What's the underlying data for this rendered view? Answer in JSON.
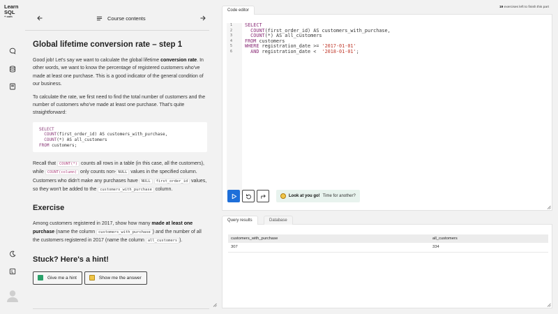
{
  "brand": {
    "line1": "Learn",
    "line2": "SQL",
    "line3": "+ com"
  },
  "nav": {
    "title": "Course contents"
  },
  "lesson": {
    "title": "Global lifetime conversion rate – step 1",
    "p1": {
      "a": "Good job! Let's say we want to calculate the global lifetime ",
      "b": "conversion rate",
      "c": ". In other words, we want to know the percentage of registered customers who've made at least one purchase. This is a good indicator of the general condition of our business."
    },
    "p2": "To calculate the rate, we first need to find the total number of customers and the number of customers who've made at least one purchase. That's quite straightforward:",
    "code_block": {
      "l1_kw": "SELECT",
      "l2_kw": "COUNT",
      "l2_rest": "(first_order_id) AS customers_with_purchase,",
      "l3_kw": "COUNT",
      "l3_rest": "(*) AS all_customers",
      "l4_kw": "FROM",
      "l4_rest": " customers;"
    },
    "p3": {
      "a": "Recall that ",
      "c1": "COUNT(*)",
      "b": " counts all rows in a table (in this case, all the customers), while ",
      "c2": "COUNT(column)",
      "c": " only counts non-",
      "c3": "NULL",
      "d": " values in the specified column. Customers who didn't make any purchases have ",
      "c4": "NULL",
      "c5": "first_order_id",
      "e": " values, so they won't be added to the ",
      "c6": "customers_with_purchase",
      "f": " column."
    },
    "exercise_heading": "Exercise",
    "p4": {
      "a": "Among customers registered in 2017, show how many ",
      "b": "made at least one purchase",
      "c": " (name the column ",
      "c1": "customers_with_purchase",
      "d": ") and the number of all the customers registered in 2017 (name the column ",
      "c2": "all_customers",
      "e": ")."
    },
    "hint_heading": "Stuck? Here's a hint!",
    "hint_button": "Give me a hint",
    "answer_button": "Show me the answer"
  },
  "editor": {
    "tab": "Code editor",
    "exercises_left_count": "19",
    "exercises_left_text": " exercises left to finish this part",
    "line_numbers": [
      "1",
      "2",
      "3",
      "4",
      "5",
      "6"
    ],
    "code": {
      "l1_kw": "SELECT",
      "l2_kw": "  COUNT",
      "l2_rest": "(first_order_id) AS customers_with_purchase,",
      "l3_kw": "  COUNT",
      "l3_rest": "(*) AS all_customers",
      "l4_kw": "FROM",
      "l4_rest": " customers",
      "l5_kw": "WHERE",
      "l5_mid": " registration_date >= ",
      "l5_str": "'2017-01-01'",
      "l6_kw": "  AND",
      "l6_mid": " registration_date <  ",
      "l6_str": "'2018-01-01'",
      "l6_end": ";"
    },
    "toast_bold": "Look at you go!",
    "toast_rest": " Time for another?"
  },
  "results": {
    "tab_active": "Query results",
    "tab_inactive": "Database",
    "columns": [
      "customers_with_purchase",
      "all_customers"
    ],
    "rows": [
      [
        "307",
        "334"
      ]
    ]
  }
}
